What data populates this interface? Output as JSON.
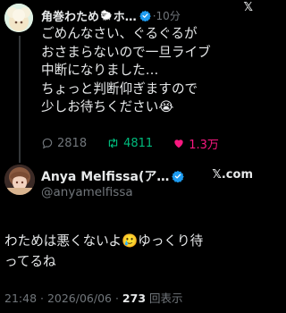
{
  "tweet1": {
    "author_name": "角巻わため",
    "author_name_rest": "ホ…",
    "sheep_emoji": "🐑",
    "time": "·10分",
    "x_logo": "𝕏",
    "body_lines": [
      "ごめんなさい、ぐるぐるが",
      "おさまらないので一旦ライブ",
      "中断になりました…",
      "ちょっと判断仰ぎますので",
      "少しお待ちください😭"
    ],
    "replies": "2818",
    "retweets": "4811",
    "likes": "1.3万"
  },
  "tweet2": {
    "author_name": "Anya Melfissa(ア…",
    "brand": "𝕏.com",
    "handle": "@anyamelfissa",
    "body_lines": [
      "わためは悪くないよ🥲ゆっくり待",
      "ってるね"
    ],
    "meta_prefix": "21:48 · 2026/06/06 · ",
    "views_count": "273",
    "views_label": " 回表示"
  },
  "colors": {
    "background": "#000000",
    "text": "#e7e9ea",
    "muted": "#71767b",
    "retweet": "#00ba7c",
    "like": "#f91880",
    "verified": "#1d9bf0"
  }
}
